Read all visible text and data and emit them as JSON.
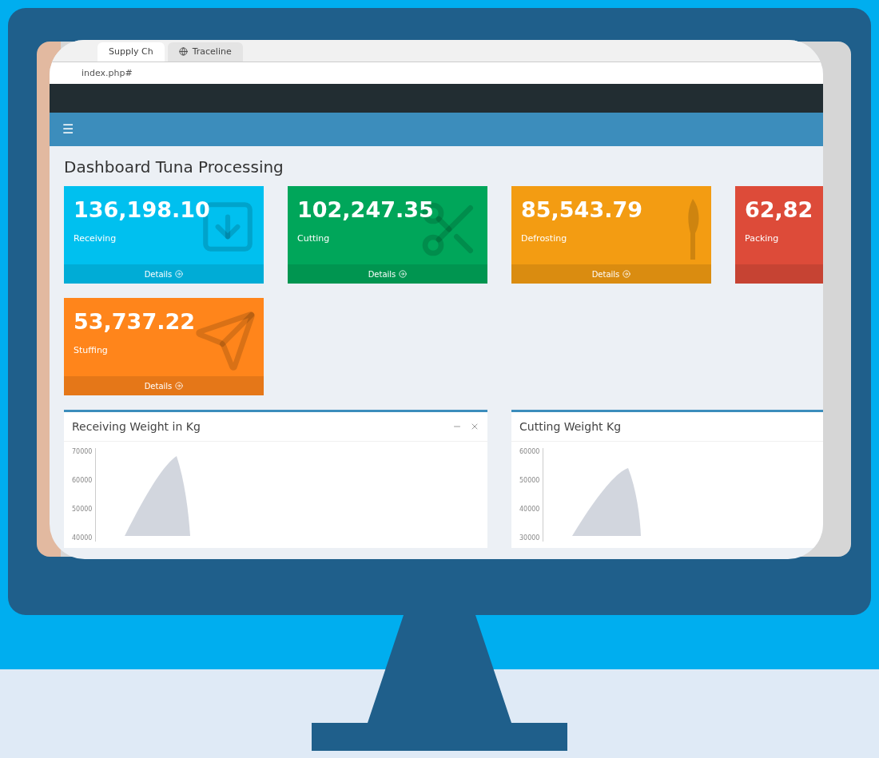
{
  "browser": {
    "tabs": [
      {
        "title": "Supply Ch",
        "selected": true
      },
      {
        "title": "Traceline",
        "selected": false
      }
    ],
    "address": "index.php#"
  },
  "header": {
    "menu_icon": "☰"
  },
  "page_title": "Dashboard Tuna Processing",
  "stat_cards": [
    {
      "value": "136,198.10",
      "label": "Receiving",
      "details": "Details",
      "color": "#00c0ef"
    },
    {
      "value": "102,247.35",
      "label": "Cutting",
      "details": "Details",
      "color": "#00a65a"
    },
    {
      "value": "85,543.79",
      "label": "Defrosting",
      "details": "Details",
      "color": "#f39c12"
    },
    {
      "value": "62,82",
      "label": "Packing",
      "color": "#dd4b39"
    },
    {
      "value": "53,737.22",
      "label": "Stuffing",
      "details": "Details",
      "color": "#ff851b"
    }
  ],
  "chart_boxes": [
    {
      "title": "Receiving Weight in Kg",
      "controls": true,
      "y_axis_labels": [
        "70000",
        "60000",
        "50000",
        "40000"
      ]
    },
    {
      "title": "Cutting Weight Kg",
      "controls": false,
      "y_axis_labels": [
        "60000",
        "50000",
        "40000",
        "30000"
      ]
    }
  ]
}
